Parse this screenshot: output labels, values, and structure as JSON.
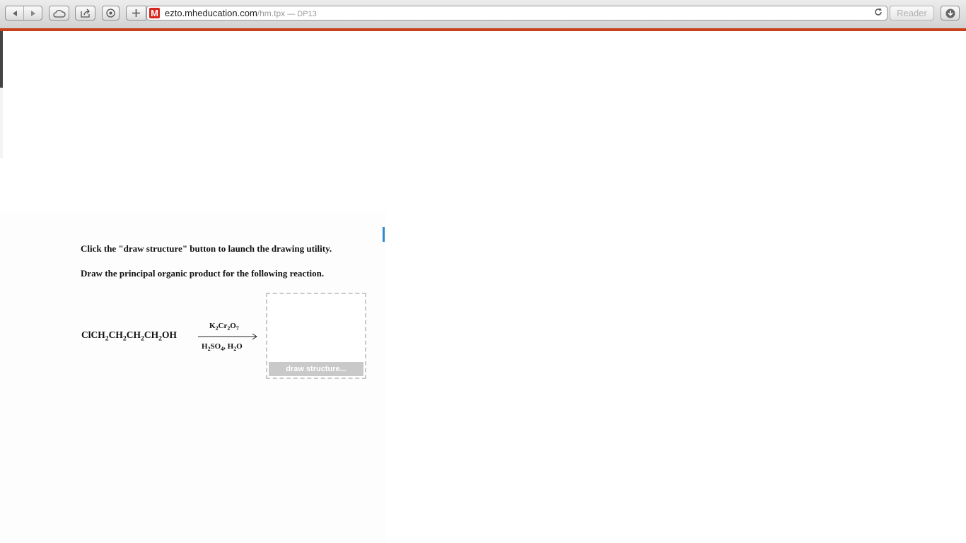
{
  "browser": {
    "address": {
      "domain": "ezto.mheducation.com",
      "path": "/hm.tpx",
      "title_separator": " — ",
      "page_title": "DP13",
      "favicon_letter": "M"
    },
    "reader_label": "Reader",
    "icons": {
      "back": "back-arrow-icon",
      "forward": "forward-arrow-icon",
      "icloud": "cloud-icon",
      "share": "share-icon",
      "topsites": "top-sites-icon",
      "new_tab": "plus-icon",
      "reload": "reload-icon",
      "downloads": "download-icon"
    },
    "accent_color": "#c8401b"
  },
  "question": {
    "instruction_1": "Click the \"draw structure\" button to launch the drawing utility.",
    "instruction_2": "Draw the principal organic product for the following reaction.",
    "reactant": {
      "p1": "ClCH",
      "s1": "2",
      "p2": "CH",
      "s2": "2",
      "p3": "CH",
      "s3": "2",
      "p4": "CH",
      "s4": "2",
      "p5": "OH"
    },
    "reagent_top": {
      "p1": "K",
      "s1": "2",
      "p2": "Cr",
      "s2": "2",
      "p3": "O",
      "s3": "7"
    },
    "reagent_bottom": {
      "p1": "H",
      "s1": "2",
      "p2": "SO",
      "s2": "4",
      "p3": ", H",
      "s3": "2",
      "p4": "O"
    },
    "draw_button_label": "draw structure..."
  }
}
